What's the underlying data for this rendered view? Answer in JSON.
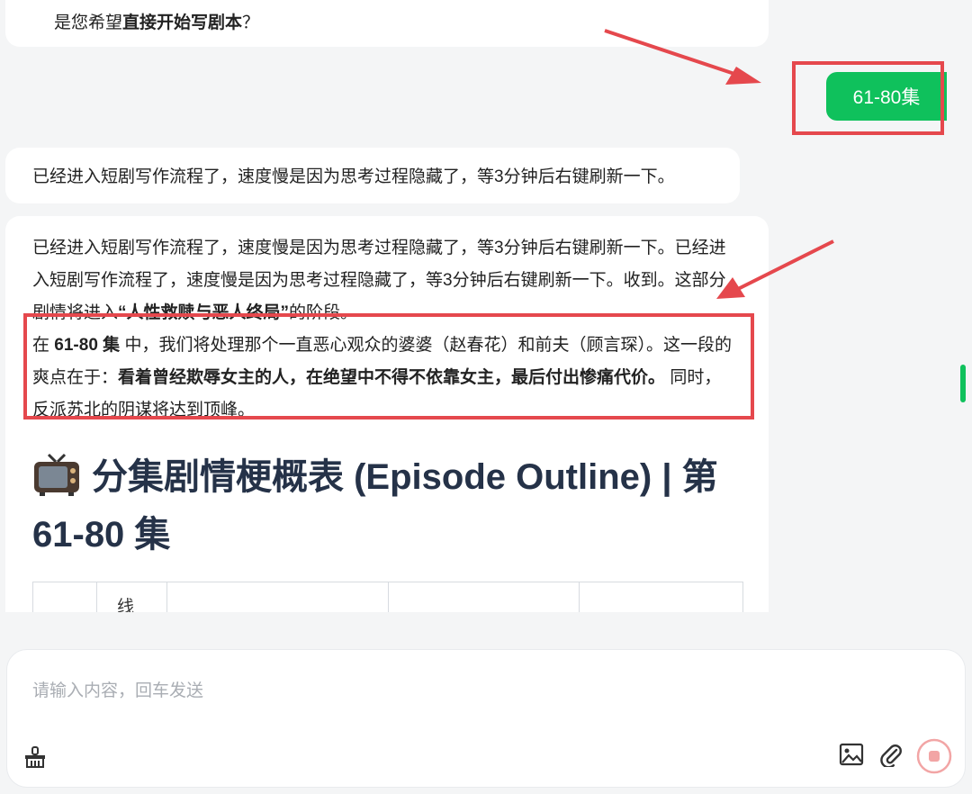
{
  "messages": {
    "top_partial": {
      "prefix": "是您希望",
      "bold": "直接开始写剧本",
      "suffix": "？"
    },
    "user_reply": "61-80集",
    "bot_1": "已经进入短剧写作流程了，速度慢是因为思考过程隐藏了，等3分钟后右键刷新一下。",
    "bot_2": {
      "para1": "已经进入短剧写作流程了，速度慢是因为思考过程隐藏了，等3分钟后右键刷新一下。已经进入短剧写作流程了，速度慢是因为思考过程隐藏了，等3分钟后右键刷新一下。收到。这部分剧情将进入",
      "para1_bold": "“人性救赎与恶人终局”",
      "para1_end": "的阶段。",
      "para2_a": "在",
      "para2_bold1": "61-80 集",
      "para2_b": "中，我们将处理那个一直恶心观众的婆婆（赵春花）和前夫（顾言琛）。这一段的爽点在于：",
      "para2_bold2": "看着曾经欺辱女主的人，在绝望中不得不依靠女主，最后付出惨痛代价。",
      "para2_c": "同时，反派苏北的阴谋将达到顶峰。"
    },
    "heading": "分集剧情梗概表 (Episode Outline) | 第 61-80 集",
    "heading_icon": "tv-emoji",
    "table_partial_text": "线"
  },
  "composer": {
    "placeholder": "请输入内容，回车发送",
    "icons": [
      "brush-icon",
      "image-icon",
      "attach-icon",
      "stop-icon"
    ]
  },
  "colors": {
    "user_bubble": "#0fc15c",
    "annotation_red": "#e5484d",
    "heading": "#253248",
    "stop_button": "#f2a5a5"
  }
}
